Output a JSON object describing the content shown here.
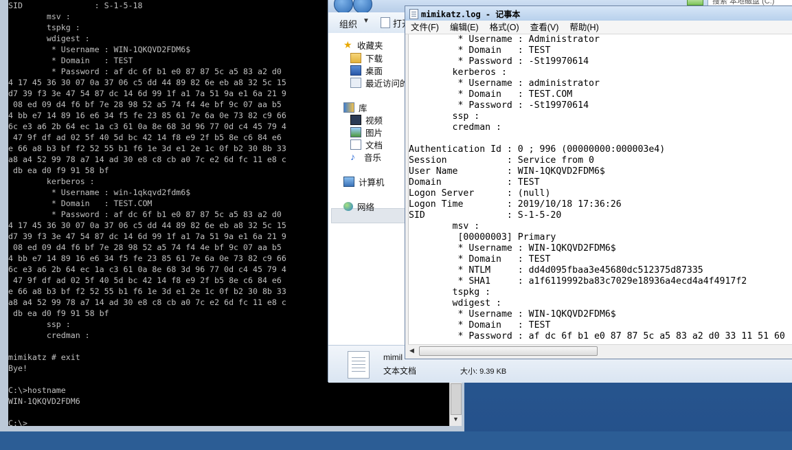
{
  "console": {
    "lines": [
      "SID               : S-1-5-18",
      "        msv :",
      "        tspkg :",
      "        wdigest :",
      "         * Username : WIN-1QKQVD2FDM6$",
      "         * Domain   : TEST",
      "         * Password : af dc 6f b1 e0 87 87 5c a5 83 a2 d0",
      "4 17 45 36 30 07 0a 37 06 c5 dd 44 89 82 6e eb a8 32 5c 15",
      "d7 39 f3 3e 47 54 87 dc 14 6d 99 1f a1 7a 51 9a e1 6a 21 9",
      " 08 ed 09 d4 f6 bf 7e 28 98 52 a5 74 f4 4e bf 9c 07 aa b5",
      "4 bb e7 14 89 16 e6 34 f5 fe 23 85 61 7e 6a 0e 73 82 c9 66",
      "6c e3 a6 2b 64 ec 1a c3 61 0a 8e 68 3d 96 77 0d c4 45 79 4",
      " 47 9f df ad 02 5f 40 5d bc 42 14 f8 e9 2f b5 8e c6 84 e6",
      "e 66 a8 b3 bf f2 52 55 b1 f6 1e 3d e1 2e 1c 0f b2 30 8b 33",
      "a8 a4 52 99 78 a7 14 ad 30 e8 c8 cb a0 7c e2 6d fc 11 e8 c",
      " db ea d0 f9 91 58 bf",
      "        kerberos :",
      "         * Username : win-1qkqvd2fdm6$",
      "         * Domain   : TEST.COM",
      "         * Password : af dc 6f b1 e0 87 87 5c a5 83 a2 d0",
      "4 17 45 36 30 07 0a 37 06 c5 dd 44 89 82 6e eb a8 32 5c 15",
      "d7 39 f3 3e 47 54 87 dc 14 6d 99 1f a1 7a 51 9a e1 6a 21 9",
      " 08 ed 09 d4 f6 bf 7e 28 98 52 a5 74 f4 4e bf 9c 07 aa b5",
      "4 bb e7 14 89 16 e6 34 f5 fe 23 85 61 7e 6a 0e 73 82 c9 66",
      "6c e3 a6 2b 64 ec 1a c3 61 0a 8e 68 3d 96 77 0d c4 45 79 4",
      " 47 9f df ad 02 5f 40 5d bc 42 14 f8 e9 2f b5 8e c6 84 e6",
      "e 66 a8 b3 bf f2 52 55 b1 f6 1e 3d e1 2e 1c 0f b2 30 8b 33",
      "a8 a4 52 99 78 a7 14 ad 30 e8 c8 cb a0 7c e2 6d fc 11 e8 c",
      " db ea d0 f9 91 58 bf",
      "        ssp :",
      "        credman :",
      "",
      "mimikatz # exit",
      "Bye!",
      "",
      "C:\\>hostname",
      "WIN-1QKQVD2FDM6",
      "",
      "C:\\>"
    ]
  },
  "explorer": {
    "toolbar": {
      "organize": "组织",
      "open": "打开"
    },
    "nav": {
      "favorites": "收藏夹",
      "downloads": "下载",
      "desktop": "桌面",
      "recent": "最近访问的",
      "libraries": "库",
      "videos": "视频",
      "pictures": "图片",
      "documents": "文档",
      "music": "音乐",
      "computer": "计算机",
      "network": "网络"
    },
    "details": {
      "file_name": "mimil",
      "file_type": "文本文档",
      "size": "大小: 9.39 KB"
    },
    "search": "搜索 本地磁盘 (C:)"
  },
  "notepad": {
    "title": "mimikatz.log - 记事本",
    "menu": [
      "文件(F)",
      "编辑(E)",
      "格式(O)",
      "查看(V)",
      "帮助(H)"
    ],
    "lines": [
      "         * Username : Administrator",
      "         * Domain   : TEST",
      "         * Password : -St19970614",
      "        kerberos :",
      "         * Username : administrator",
      "         * Domain   : TEST.COM",
      "         * Password : -St19970614",
      "        ssp :",
      "        credman :",
      "",
      "Authentication Id : 0 ; 996 (00000000:000003e4)",
      "Session           : Service from 0",
      "User Name         : WIN-1QKQVD2FDM6$",
      "Domain            : TEST",
      "Logon Server      : (null)",
      "Logon Time        : 2019/10/18 17:36:26",
      "SID               : S-1-5-20",
      "        msv :",
      "         [00000003] Primary",
      "         * Username : WIN-1QKQVD2FDM6$",
      "         * Domain   : TEST",
      "         * NTLM     : dd4d095fbaa3e45680dc512375d87335",
      "         * SHA1     : a1f6119992ba83c7029e18936a4ecd4a4f4917f2",
      "        tspkg :",
      "        wdigest :",
      "         * Username : WIN-1QKQVD2FDM6$",
      "         * Domain   : TEST",
      "         * Password : af dc 6f b1 e0 87 87 5c a5 83 a2 d0 33 11 51 60"
    ]
  }
}
